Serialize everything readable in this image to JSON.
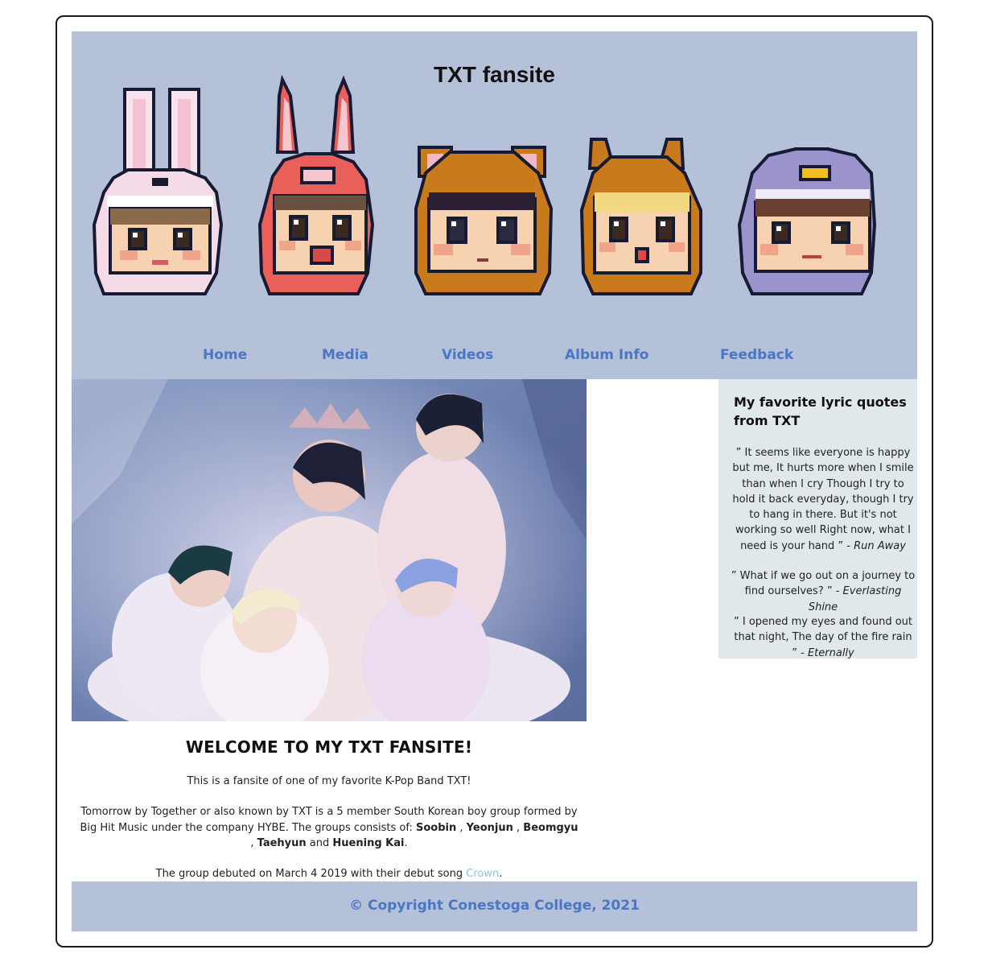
{
  "header": {
    "title": "TXT fansite",
    "characters": [
      {
        "icon": "bunny-hood-chibi-icon",
        "hood_color": "#f4dbe7"
      },
      {
        "icon": "red-rabbit-hood-chibi-icon",
        "hood_color": "#e9605a"
      },
      {
        "icon": "bear-hood-chibi-icon",
        "hood_color": "#c87a1c"
      },
      {
        "icon": "fox-hood-chibi-icon",
        "hood_color": "#c87a1c"
      },
      {
        "icon": "penguin-hood-chibi-icon",
        "hood_color": "#9b93cc"
      }
    ]
  },
  "nav": {
    "items": [
      {
        "label": "Home"
      },
      {
        "label": "Media"
      },
      {
        "label": "Videos"
      },
      {
        "label": "Album Info"
      },
      {
        "label": "Feedback"
      }
    ]
  },
  "sidebar": {
    "title": "My favorite lyric quotes from TXT",
    "quotes": [
      {
        "text": "” It seems like everyone is happy but me, It hurts more when I smile than when I cry Though I try to hold it back everyday, though I try to hang in there. But it's not working so well Right now, what I need is your hand ” - ",
        "song": "Run Away"
      },
      {
        "text": "” What if we go out on a journey to find ourselves? ” - ",
        "song": "Everlasting Shine"
      },
      {
        "text": "” I opened my eyes and found out that night, The day of the fire rain ” - ",
        "song": "Eternally"
      }
    ]
  },
  "main": {
    "heading": "WELCOME TO MY TXT FANSITE!",
    "intro": "This is a fansite of one of my favorite K-Pop Band TXT!",
    "about_prefix": "Tomorrow by Together or also known by TXT is a 5 member South Korean boy group formed by Big Hit Music under the company HYBE. The groups consists of: ",
    "members": [
      "Soobin",
      "Yeonjun",
      "Beomgyu",
      "Taehyun",
      "Huening Kai"
    ],
    "sep": " , ",
    "and": " and ",
    "period": ".",
    "debut_prefix": "The group debuted on March 4 2019 with their debut song ",
    "debut_song": "Crown",
    "debut_suffix": ".",
    "link_color": "#8fc6e6"
  },
  "footer": {
    "text": "© Copyright Conestoga College, 2021"
  },
  "colors": {
    "header_bg": "#b4c1d8",
    "nav_text": "#4a76c4",
    "sidebar_bg": "#e1e8ec"
  }
}
